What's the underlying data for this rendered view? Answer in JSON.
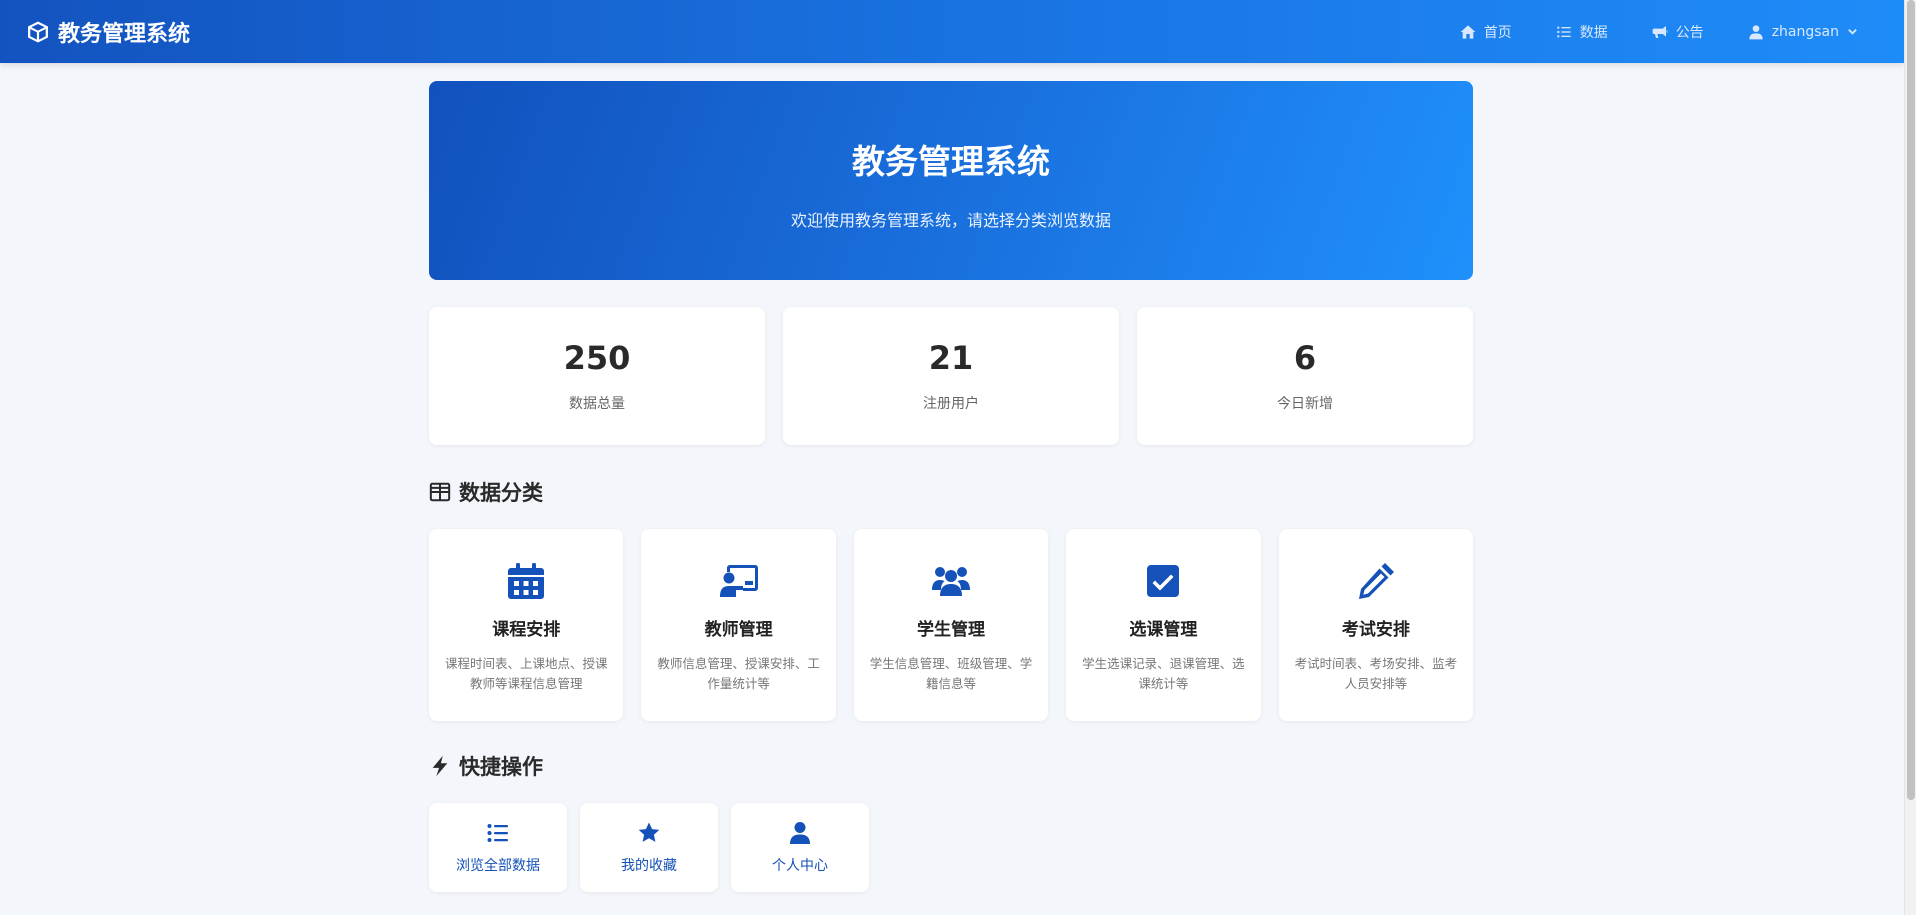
{
  "navbar": {
    "brand": "教务管理系统",
    "links": [
      {
        "label": "首页",
        "icon": "home-icon"
      },
      {
        "label": "数据",
        "icon": "list-icon"
      },
      {
        "label": "公告",
        "icon": "megaphone-icon"
      }
    ],
    "user": {
      "name": "zhangsan",
      "icon": "user-icon"
    }
  },
  "hero": {
    "title": "教务管理系统",
    "subtitle": "欢迎使用教务管理系统，请选择分类浏览数据"
  },
  "stats": [
    {
      "value": "250",
      "label": "数据总量"
    },
    {
      "value": "21",
      "label": "注册用户"
    },
    {
      "value": "6",
      "label": "今日新增"
    }
  ],
  "categories_section": {
    "title": "数据分类",
    "icon": "table-icon"
  },
  "categories": [
    {
      "title": "课程安排",
      "desc": "课程时间表、上课地点、授课教师等课程信息管理",
      "icon": "calendar-icon"
    },
    {
      "title": "教师管理",
      "desc": "教师信息管理、授课安排、工作量统计等",
      "icon": "teacher-icon"
    },
    {
      "title": "学生管理",
      "desc": "学生信息管理、班级管理、学籍信息等",
      "icon": "users-icon"
    },
    {
      "title": "选课管理",
      "desc": "学生选课记录、退课管理、选课统计等",
      "icon": "checkbox-icon"
    },
    {
      "title": "考试安排",
      "desc": "考试时间表、考场安排、监考人员安排等",
      "icon": "pencil-icon"
    }
  ],
  "quick_section": {
    "title": "快捷操作",
    "icon": "bolt-icon"
  },
  "quick_actions": [
    {
      "label": "浏览全部数据",
      "icon": "list-icon"
    },
    {
      "label": "我的收藏",
      "icon": "star-icon"
    },
    {
      "label": "个人中心",
      "icon": "user-icon"
    }
  ],
  "colors": {
    "primary": "#1451b8",
    "accent": "#1e8cf8",
    "background": "#f3f6fa"
  }
}
